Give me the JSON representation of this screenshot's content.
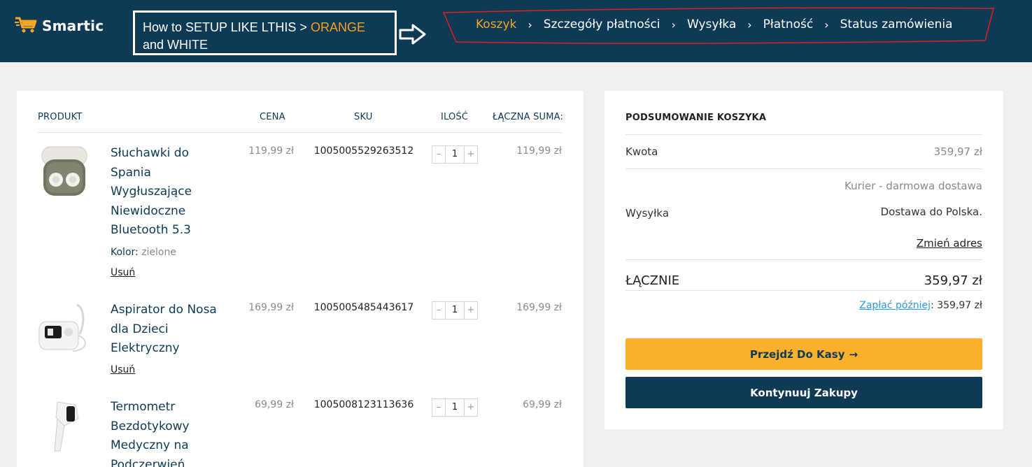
{
  "header": {
    "logo_text": "Smartic",
    "annotation": {
      "part1": "How to SETUP LIKE LTHIS > ",
      "orange": "ORANGE",
      "part2": " and WHITE"
    },
    "steps": [
      "Koszyk",
      "Szczegóły płatności",
      "Wysyłka",
      "Płatność",
      "Status zamówienia"
    ],
    "active_step": 0
  },
  "cart": {
    "columns": {
      "product": "PRODUKT",
      "price": "CENA",
      "sku": "SKU",
      "qty": "ILOŚĆ",
      "total": "ŁĄCZNA SUMA:"
    },
    "items": [
      {
        "name": "Słuchawki do Spania Wygłuszające Niewidoczne Bluetooth 5.3",
        "color_label": "Kolor:",
        "color_value": "zielone",
        "remove": "Usuń",
        "price": "119,99 zł",
        "sku": "1005005529263512",
        "qty": "1",
        "total": "119,99 zł",
        "image_icon": "earbuds-icon"
      },
      {
        "name": "Aspirator do Nosa dla Dzieci Elektryczny",
        "remove": "Usuń",
        "price": "169,99 zł",
        "sku": "1005005485443617",
        "qty": "1",
        "total": "169,99 zł",
        "image_icon": "nasal-aspirator-icon"
      },
      {
        "name": "Termometr Bezdotykowy Medyczny na Podczerwień",
        "price": "69,99 zł",
        "sku": "1005008123113636",
        "qty": "1",
        "total": "69,99 zł",
        "image_icon": "thermometer-icon"
      }
    ],
    "qty_minus": "–",
    "qty_plus": "+"
  },
  "summary": {
    "title": "PODSUMOWANIE KOSZYKA",
    "amount_label": "Kwota",
    "amount_value": "359,97 zł",
    "shipping_label": "Wysyłka",
    "shipping_method": "Kurier - darmowa dostawa",
    "shipping_dest": "Dostawa do Polska.",
    "change_address": "Zmień adres",
    "total_label": "ŁĄCZNIE",
    "total_value": "359,97 zł",
    "pay_later_link": "Zapłać później",
    "pay_later_value": ": 359,97 zł",
    "checkout_button": "Przejdź Do Kasy",
    "checkout_arrow": "→",
    "continue_button": "Kontynuuj Zakupy"
  },
  "colors": {
    "navy": "#0e3a55",
    "orange": "#fbb02d",
    "active_step": "#f5a623",
    "link_blue": "#2e9be0"
  }
}
